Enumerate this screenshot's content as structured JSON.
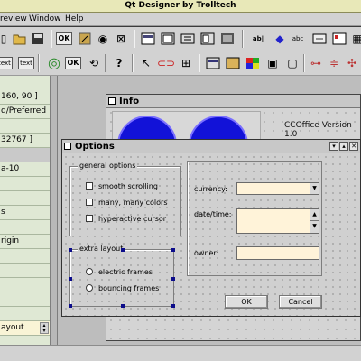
{
  "window": {
    "title": "Qt Designer by Trolltech"
  },
  "menus": [
    "review",
    "Window",
    "Help"
  ],
  "toolbar1": {
    "icons": [
      "new-icon",
      "open-icon",
      "save-icon",
      "dialog-ok-icon",
      "arrow-icon",
      "radio-icon",
      "delete-icon",
      "layout-icon",
      "checkbox-icon",
      "dropdown-icon",
      "widget-stack-icon",
      "textedit-icon",
      "spin-icon",
      "multiline-icon",
      "slider-icon",
      "button-icon",
      "grid-icon"
    ],
    "ok_label": "OK"
  },
  "toolbar2": {
    "labels": {
      "text1": "text",
      "text2": "text",
      "ok": "OK",
      "help": "?"
    },
    "icons": [
      "ok-circle-icon",
      "refresh-icon",
      "pointer-icon",
      "link-icon",
      "tab-order-icon",
      "folder-icon",
      "scroll-icon",
      "color-icon",
      "palette-icon",
      "lock-icon",
      "layout-horizontal-icon",
      "layout-vertical-icon",
      "layout-grid-icon",
      "break-layout-icon",
      "adjust-size-icon"
    ]
  },
  "property_panel": {
    "rows": [
      "160, 90 ]",
      "d/Preferred",
      "",
      "32767 ]",
      "",
      "a-10",
      "",
      "",
      "s",
      "",
      "rigin",
      "",
      "",
      "",
      "",
      "",
      "ayout"
    ]
  },
  "info_window": {
    "title": "Info",
    "version": "CCOffice Version 1.0"
  },
  "options_dialog": {
    "title": "Options",
    "general_group": {
      "title": "general options",
      "items": [
        "smooth scrolling",
        "many, many colors",
        "hyperactive cursor"
      ]
    },
    "layout_group": {
      "title": "extra layout",
      "items": [
        "electric frames",
        "bouncing frames"
      ]
    },
    "fields": {
      "currency_label": "currency:",
      "datetime_label": "date/time:",
      "owner_label": "owner:",
      "currency_value": "",
      "datetime_value": "",
      "owner_value": ""
    },
    "ok_label": "OK",
    "cancel_label": "Cancel"
  },
  "colors": {
    "titlebar": "#e8e8b8",
    "property_panel": "#dfe8d4",
    "field_bg": "#fff3d9",
    "circle_blue": "#1212d8"
  }
}
